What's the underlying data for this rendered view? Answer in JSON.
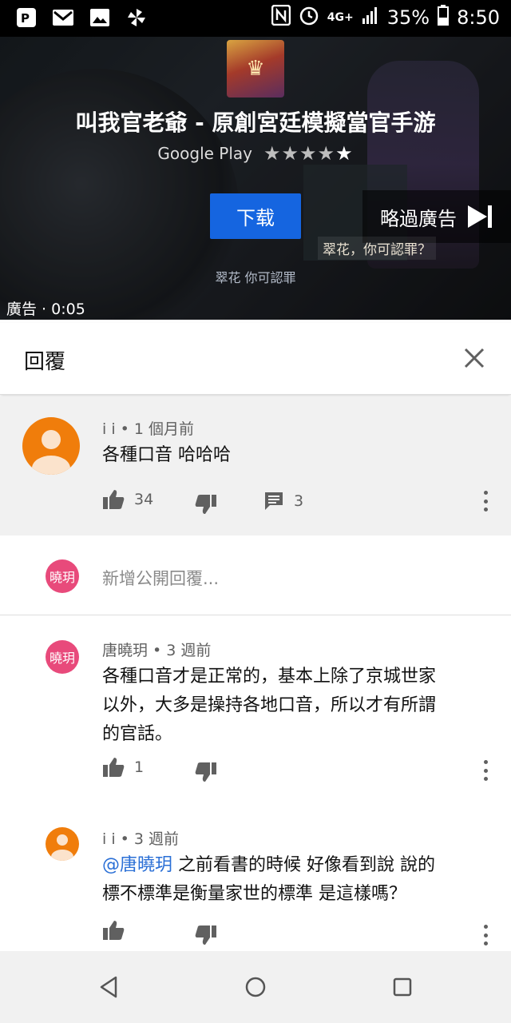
{
  "status_bar": {
    "icons_left": [
      "pocketcasts-icon",
      "gmail-icon",
      "image-icon",
      "pinwheel-icon"
    ],
    "network_label": "4G+",
    "battery": "35%",
    "time": "8:50"
  },
  "ad": {
    "app_title": "叫我官老爺 - 原創宮廷模擬當官手游",
    "store": "Google Play",
    "rating_stars": 4.5,
    "download_label": "下载",
    "skip_label": "略過廣告",
    "subtitle_side": "翠花，你可認罪？",
    "subtitle_main": "翠花  你可認罪",
    "label": "廣告 · 0:05",
    "progress_fraction": 1.0,
    "progress_color": "#f6c22b"
  },
  "panel": {
    "title": "回覆"
  },
  "top_comment": {
    "author_meta": "i i • 1 個月前",
    "text": "各種口音 哈哈哈",
    "likes": "34",
    "replies": "3"
  },
  "add_reply": {
    "avatar_text": "曉玥",
    "placeholder": "新增公開回覆..."
  },
  "replies": [
    {
      "avatar_text": "曉玥",
      "meta": "唐曉玥 • 3 週前",
      "text_lines": [
        "各種口音才是正常的，基本上除了京城世家",
        "以外，大多是操持各地口音，所以才有所謂",
        "的官話。"
      ],
      "likes": "1"
    },
    {
      "meta": "i i • 3 週前",
      "mention": "@唐曉玥",
      "text_line1_rest": " 之前看書的時候 好像看到說 說的",
      "text_line2": "標不標準是衡量家世的標準 是這樣嗎？",
      "likes": ""
    }
  ],
  "colors": {
    "accent_blue": "#1565e0",
    "avatar_orange": "#f07d0b",
    "avatar_pink": "#e84a7b",
    "mention_blue": "#2a6fd6"
  }
}
